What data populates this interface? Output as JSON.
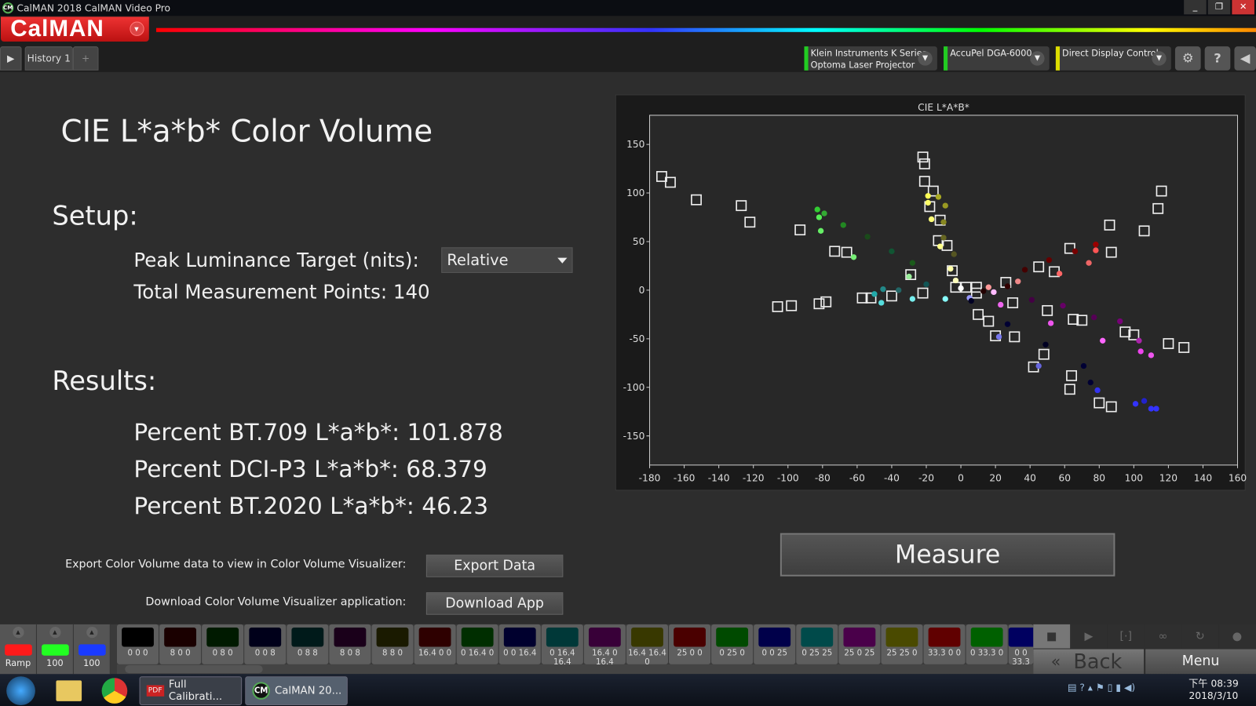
{
  "window": {
    "title": "CalMAN 2018 CalMAN Video Pro",
    "logo": "CM",
    "min": "_",
    "max": "❐",
    "close": "✕"
  },
  "brand": {
    "name": "CalMAN"
  },
  "tabs": [
    {
      "label": "History 1"
    }
  ],
  "add_tab": "+",
  "devices": [
    {
      "line1": "Klein Instruments K Series",
      "line2": "Optoma Laser Projector",
      "status_color": "#22cc22"
    },
    {
      "line1": "AccuPel DGA-6000",
      "line2": "",
      "status_color": "#22cc22"
    },
    {
      "line1": "Direct Display Control",
      "line2": "",
      "status_color": "#dddd00"
    }
  ],
  "icons": {
    "settings": "⚙",
    "help": "?",
    "collapse": "◀",
    "expand": "▶"
  },
  "page": {
    "title": "CIE L*a*b* Color Volume",
    "setup_heading": "Setup:",
    "peak_label": "Peak Luminance Target (nits):",
    "peak_value": "Relative",
    "total_points": "Total Measurement Points: 140",
    "results_heading": "Results:",
    "results": [
      "Percent BT.709 L*a*b*: 101.878",
      "Percent DCI-P3 L*a*b*: 68.379",
      "Percent BT.2020 L*a*b*: 46.23"
    ],
    "export_text": "Export Color Volume data to view in Color Volume Visualizer:",
    "export_button": "Export Data",
    "download_text": "Download Color Volume Visualizer application:",
    "download_button": "Download App",
    "measure_button": "Measure"
  },
  "chart_data": {
    "type": "scatter",
    "title": "CIE L*A*B*",
    "xlim": [
      -180,
      160
    ],
    "ylim": [
      -180,
      180
    ],
    "xticks": [
      -180,
      -160,
      -140,
      -120,
      -100,
      -80,
      -60,
      -40,
      -20,
      0,
      20,
      40,
      60,
      80,
      100,
      120,
      140,
      160
    ],
    "yticks": [
      150,
      100,
      50,
      0,
      -50,
      -100,
      -150
    ],
    "grid": false,
    "targets": [
      [
        -173,
        117
      ],
      [
        -168,
        111
      ],
      [
        -153,
        93
      ],
      [
        -127,
        87
      ],
      [
        -122,
        70
      ],
      [
        -93,
        62
      ],
      [
        -73,
        40
      ],
      [
        -66,
        39
      ],
      [
        -29,
        16
      ],
      [
        -22,
        -3
      ],
      [
        -52,
        -8
      ],
      [
        -57,
        -8
      ],
      [
        -40,
        -6
      ],
      [
        -106,
        -17
      ],
      [
        -98,
        -16
      ],
      [
        -82,
        -14
      ],
      [
        -78,
        -12
      ],
      [
        -22,
        137
      ],
      [
        -21,
        130
      ],
      [
        -21,
        112
      ],
      [
        -16,
        102
      ],
      [
        -18,
        86
      ],
      [
        -12,
        72
      ],
      [
        -13,
        51
      ],
      [
        -8,
        46
      ],
      [
        -5,
        20
      ],
      [
        -3,
        3
      ],
      [
        3,
        3
      ],
      [
        9,
        3
      ],
      [
        9,
        -3
      ],
      [
        26,
        8
      ],
      [
        45,
        24
      ],
      [
        54,
        19
      ],
      [
        63,
        43
      ],
      [
        86,
        67
      ],
      [
        87,
        39
      ],
      [
        106,
        61
      ],
      [
        116,
        102
      ],
      [
        114,
        84
      ],
      [
        30,
        -13
      ],
      [
        10,
        -25
      ],
      [
        16,
        -32
      ],
      [
        20,
        -47
      ],
      [
        31,
        -48
      ],
      [
        50,
        -21
      ],
      [
        65,
        -30
      ],
      [
        70,
        -31
      ],
      [
        95,
        -43
      ],
      [
        100,
        -46
      ],
      [
        120,
        -55
      ],
      [
        129,
        -59
      ],
      [
        48,
        -66
      ],
      [
        42,
        -79
      ],
      [
        64,
        -88
      ],
      [
        63,
        -102
      ],
      [
        80,
        -116
      ],
      [
        87,
        -120
      ]
    ],
    "measured": [
      [
        -83,
        83,
        "#33cc33"
      ],
      [
        -79,
        79,
        "#33aa33"
      ],
      [
        -82,
        75,
        "#55ee55"
      ],
      [
        -81,
        61,
        "#66ee66"
      ],
      [
        -68,
        67,
        "#228822"
      ],
      [
        -54,
        55,
        "#1a4a1a"
      ],
      [
        -40,
        40,
        "#115533"
      ],
      [
        -62,
        34,
        "#77ee77"
      ],
      [
        -28,
        28,
        "#1a5a1a"
      ],
      [
        -30,
        14,
        "#99ee99"
      ],
      [
        -28,
        -9,
        "#77eeee"
      ],
      [
        -46,
        -13,
        "#55dddd"
      ],
      [
        -50,
        -4,
        "#22aaaa"
      ],
      [
        -45,
        1,
        "#228888"
      ],
      [
        -36,
        0,
        "#226666"
      ],
      [
        -20,
        6,
        "#115555"
      ],
      [
        -9,
        -9,
        "#88ffff"
      ],
      [
        -19,
        97,
        "#ffff55"
      ],
      [
        -13,
        96,
        "#aaaa22"
      ],
      [
        -19,
        90,
        "#ffff66"
      ],
      [
        -9,
        87,
        "#999922"
      ],
      [
        -17,
        73,
        "#ffff77"
      ],
      [
        -10,
        70,
        "#888822"
      ],
      [
        -10,
        54,
        "#666622"
      ],
      [
        -12,
        45,
        "#ffff88"
      ],
      [
        -4,
        37,
        "#555522"
      ],
      [
        -6,
        22,
        "#ffffaa"
      ],
      [
        -3,
        10,
        "#ffffbb"
      ],
      [
        78,
        47,
        "#990000"
      ],
      [
        78,
        41,
        "#ff5555"
      ],
      [
        66,
        40,
        "#770000"
      ],
      [
        74,
        28,
        "#ee6666"
      ],
      [
        57,
        17,
        "#ff6666"
      ],
      [
        51,
        31,
        "#660000"
      ],
      [
        37,
        21,
        "#440000"
      ],
      [
        33,
        9,
        "#ee8888"
      ],
      [
        27,
        4,
        "#330000"
      ],
      [
        16,
        3,
        "#ff9999"
      ],
      [
        13,
        -1,
        "#220000"
      ],
      [
        77,
        -28,
        "#550055"
      ],
      [
        59,
        -16,
        "#660066"
      ],
      [
        41,
        -10,
        "#440044"
      ],
      [
        23,
        -15,
        "#ee66ee"
      ],
      [
        52,
        -34,
        "#ee55ee"
      ],
      [
        92,
        -32,
        "#770077"
      ],
      [
        103,
        -52,
        "#aa22aa"
      ],
      [
        104,
        -63,
        "#ee44ee"
      ],
      [
        110,
        -67,
        "#ee55ee"
      ],
      [
        82,
        -52,
        "#ff66ff"
      ],
      [
        19,
        -2,
        "#ffbbff"
      ],
      [
        5,
        -8,
        "#9999ff"
      ],
      [
        22,
        -48,
        "#7777ee"
      ],
      [
        45,
        -78,
        "#6666dd"
      ],
      [
        49,
        -56,
        "#000022"
      ],
      [
        27,
        -35,
        "#000033"
      ],
      [
        6,
        -11,
        "#000022"
      ],
      [
        71,
        -78,
        "#000033"
      ],
      [
        75,
        -95,
        "#000033"
      ],
      [
        79,
        -103,
        "#3333ee"
      ],
      [
        101,
        -117,
        "#3333ff"
      ],
      [
        106,
        -114,
        "#2222cc"
      ],
      [
        110,
        -122,
        "#3333ff"
      ],
      [
        113,
        -122,
        "#3333ff"
      ],
      [
        0,
        2,
        "#ffffff"
      ]
    ]
  },
  "ramp": [
    {
      "label": "Ramp",
      "color": "#ff1a1a"
    },
    {
      "label": "100",
      "color": "#22ff22"
    },
    {
      "label": "100",
      "color": "#1a3aff"
    }
  ],
  "swatches": [
    {
      "label": "0 0 0",
      "color": "#000000"
    },
    {
      "label": "8 0 0",
      "color": "#1a0000"
    },
    {
      "label": "0 8 0",
      "color": "#001a00"
    },
    {
      "label": "0 0 8",
      "color": "#00001a"
    },
    {
      "label": "0 8 8",
      "color": "#001a1a"
    },
    {
      "label": "8 0 8",
      "color": "#1a001a"
    },
    {
      "label": "8 8 0",
      "color": "#1a1a00"
    },
    {
      "label": "16.4 0 0",
      "color": "#2e0000"
    },
    {
      "label": "0 16.4 0",
      "color": "#002e00"
    },
    {
      "label": "0 0 16.4",
      "color": "#00002e"
    },
    {
      "label": "0 16.4 16.4",
      "color": "#003838"
    },
    {
      "label": "16.4 0 16.4",
      "color": "#380038"
    },
    {
      "label": "16.4 16.4 0",
      "color": "#383800"
    },
    {
      "label": "25 0 0",
      "color": "#4a0000"
    },
    {
      "label": "0 25 0",
      "color": "#004a00"
    },
    {
      "label": "0 0 25",
      "color": "#00004a"
    },
    {
      "label": "0 25 25",
      "color": "#004a4a"
    },
    {
      "label": "25 0 25",
      "color": "#4a004a"
    },
    {
      "label": "25 25 0",
      "color": "#4a4a00"
    },
    {
      "label": "33.3 0 0",
      "color": "#600000"
    },
    {
      "label": "0 33.3 0",
      "color": "#006000"
    },
    {
      "label": "0 0 33.3",
      "color": "#000060"
    }
  ],
  "controls": [
    "■",
    "▶",
    "[·]",
    "∞",
    "↻",
    "●"
  ],
  "nav": {
    "back": "Back",
    "back_icon": "«",
    "menu": "Menu"
  },
  "taskbar": {
    "items": [
      {
        "label": "Full Calibrati...",
        "icon": "PDF"
      },
      {
        "label": "CalMAN 20...",
        "icon": "CM"
      }
    ],
    "time": "下午 08:39",
    "date": "2018/3/10"
  }
}
